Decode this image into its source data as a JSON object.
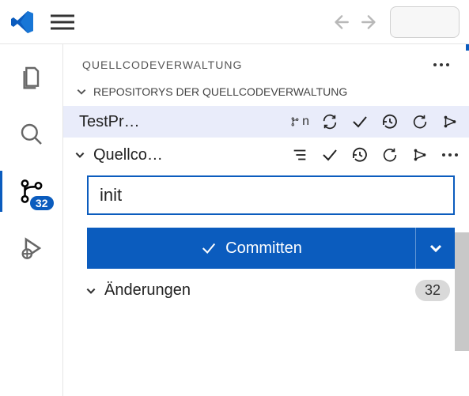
{
  "panel": {
    "title": "QUELLCODEVERWALTUNG",
    "repos_section": "REPOSITORYS DER QUELLCODEVERWALTUNG"
  },
  "repo": {
    "name": "TestPr…",
    "branch": "n"
  },
  "scm": {
    "label": "Quellco…"
  },
  "commit": {
    "message": "init",
    "button": "Committen"
  },
  "changes": {
    "label": "Änderungen",
    "count": "32"
  },
  "activity": {
    "scm_badge": "32"
  }
}
